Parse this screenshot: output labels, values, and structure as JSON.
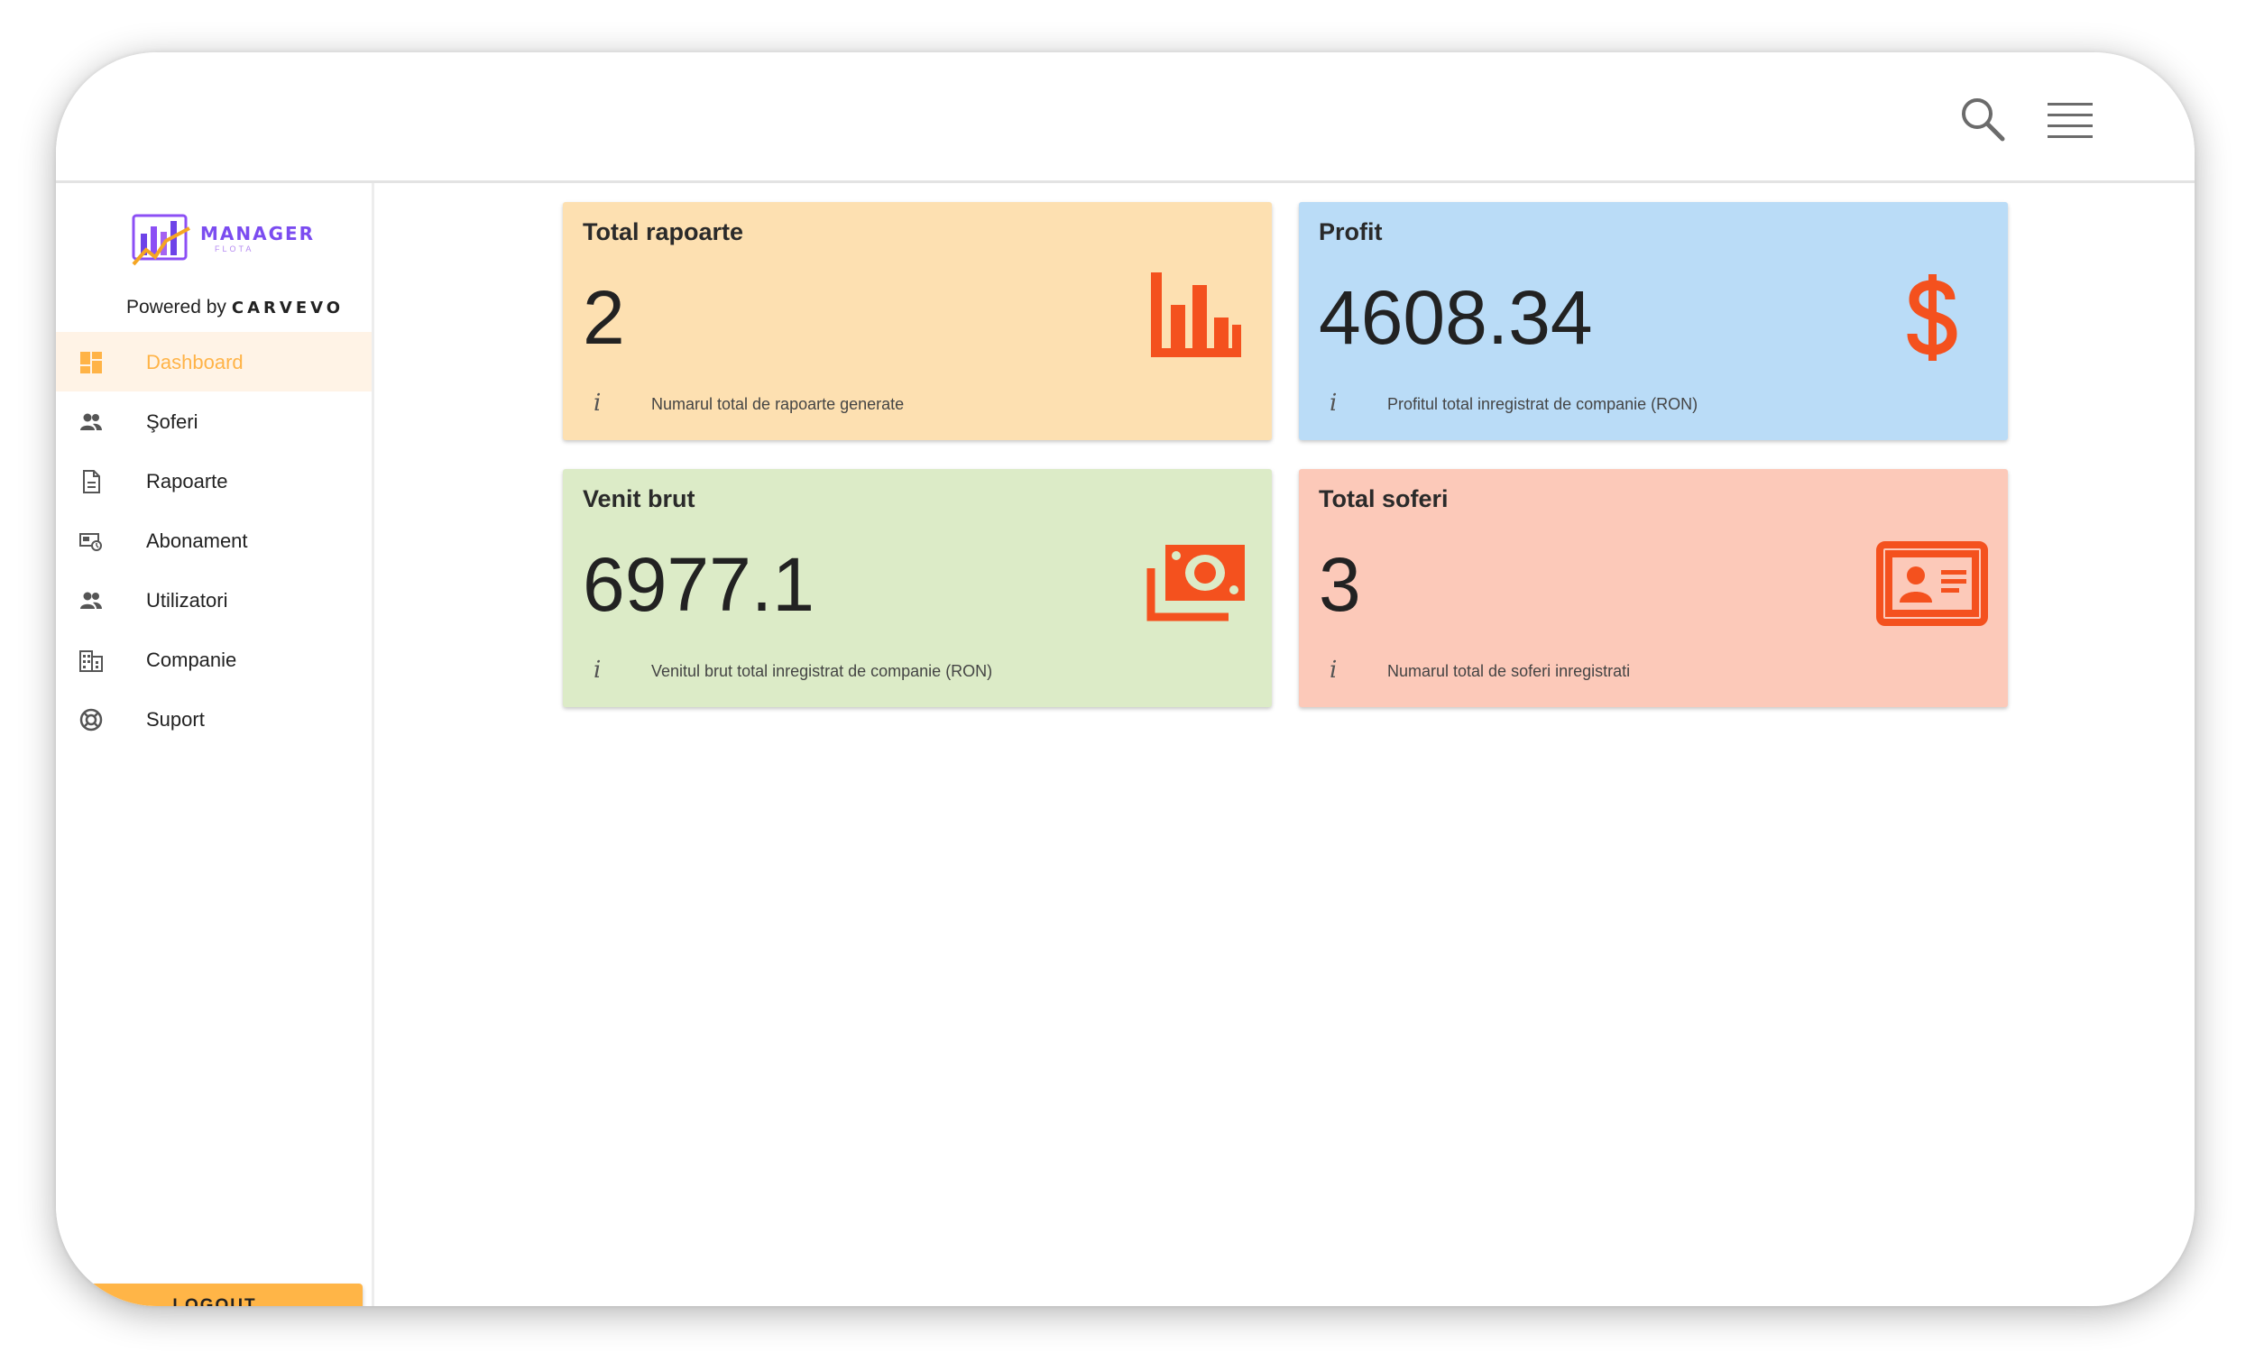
{
  "header": {
    "search_icon": "search-icon",
    "menu_icon": "hamburger-menu-icon"
  },
  "sidebar": {
    "logo": {
      "text": "MANAGER",
      "subtext": "FLOTA"
    },
    "powered_by": "Powered by",
    "powered_brand": "CARVEVO",
    "items": [
      {
        "label": "Dashboard",
        "icon": "dashboard-icon",
        "active": true
      },
      {
        "label": "Şoferi",
        "icon": "people-icon"
      },
      {
        "label": "Rapoarte",
        "icon": "document-icon"
      },
      {
        "label": "Abonament",
        "icon": "subscription-icon"
      },
      {
        "label": "Utilizatori",
        "icon": "people-icon"
      },
      {
        "label": "Companie",
        "icon": "building-icon"
      },
      {
        "label": "Suport",
        "icon": "support-icon"
      }
    ],
    "logout_label": "LOGOUT"
  },
  "cards": [
    {
      "title": "Total rapoarte",
      "value": "2",
      "desc": "Numarul total de rapoarte generate",
      "icon": "bar-chart-icon"
    },
    {
      "title": "Profit",
      "value": "4608.34",
      "desc": "Profitul total inregistrat de companie (RON)",
      "icon": "dollar-icon"
    },
    {
      "title": "Venit brut",
      "value": "6977.1",
      "desc": "Venitul brut total inregistrat de companie (RON)",
      "icon": "money-icon"
    },
    {
      "title": "Total soferi",
      "value": "3",
      "desc": "Numarul total de soferi inregistrati",
      "icon": "id-card-icon"
    }
  ],
  "info_glyph": "i",
  "colors": {
    "accent": "#ffb547",
    "icon_orange": "#f4511e",
    "card_orange": "#fde0b1",
    "card_blue": "#badcf7",
    "card_green": "#dcebc7",
    "card_red": "#fcc9b9"
  }
}
